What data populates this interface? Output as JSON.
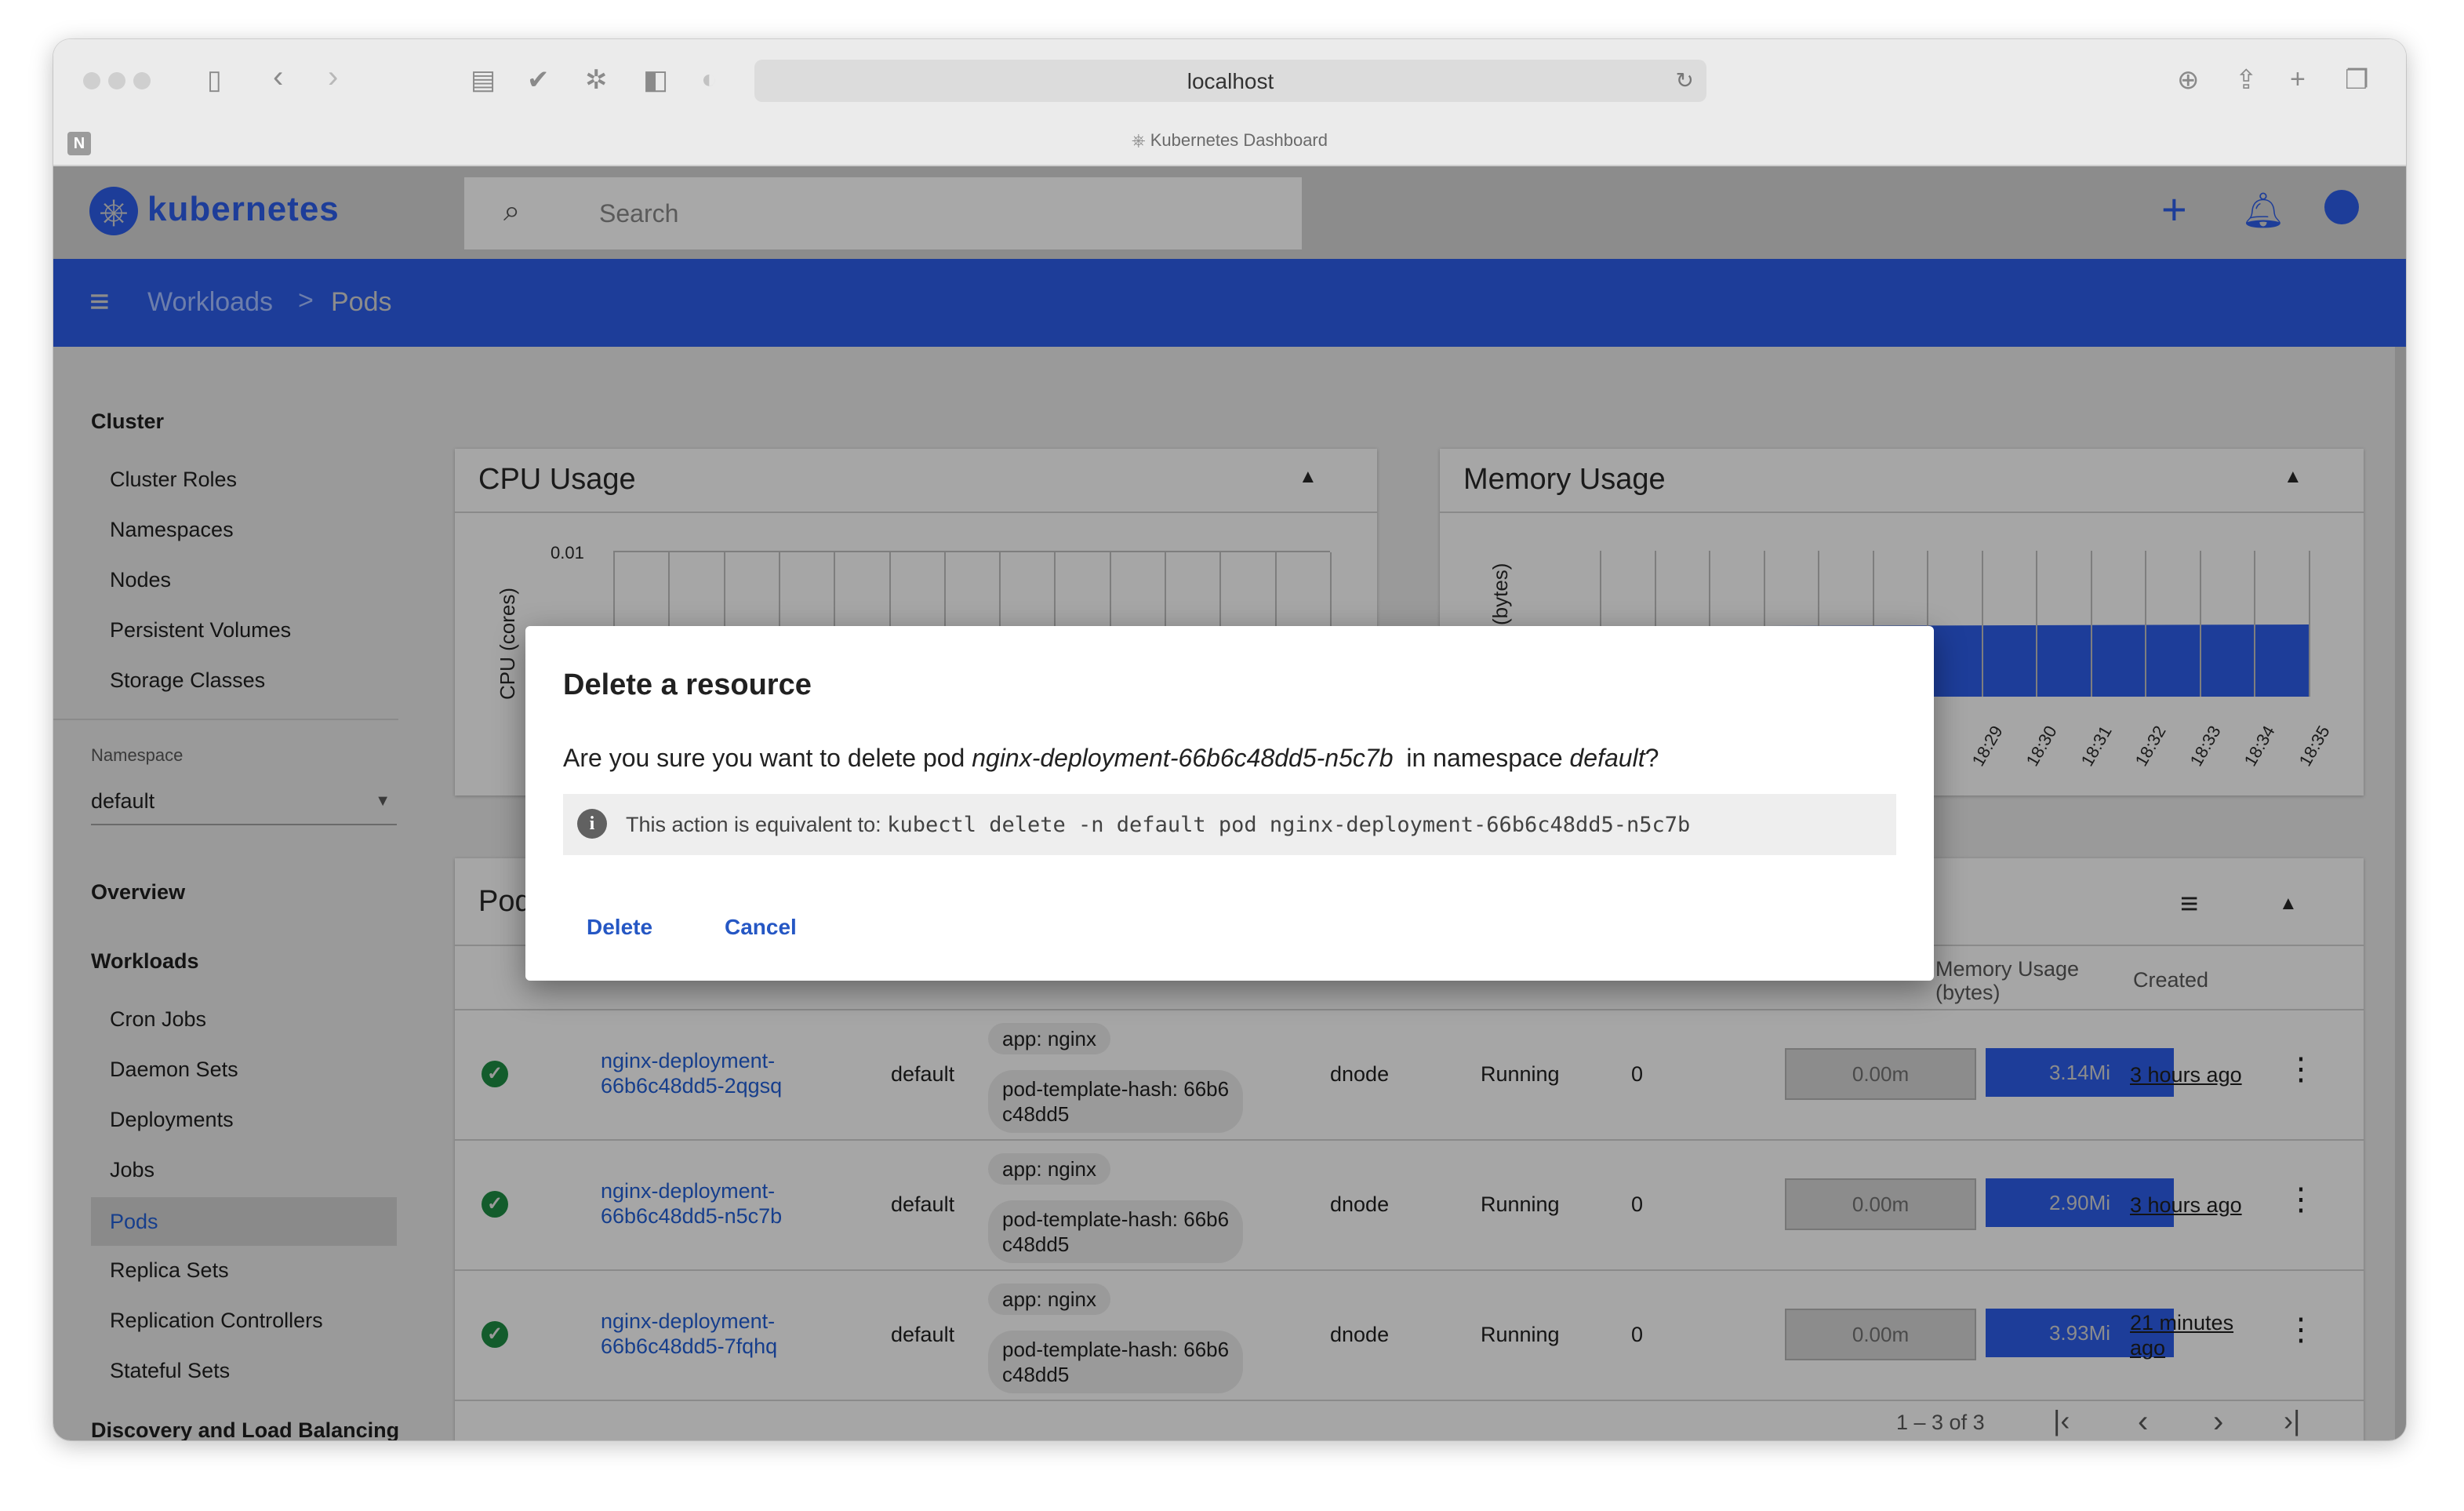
{
  "browser": {
    "url": "localhost",
    "tab_title": "Kubernetes Dashboard",
    "left_tab_letter": "N"
  },
  "app": {
    "brand": "kubernetes",
    "search_placeholder": "Search"
  },
  "breadcrumb": {
    "parent": "Workloads",
    "separator": ">",
    "current": "Pods"
  },
  "sidebar": {
    "cluster_header": "Cluster",
    "cluster_items": [
      "Cluster Roles",
      "Namespaces",
      "Nodes",
      "Persistent Volumes",
      "Storage Classes"
    ],
    "namespace_label": "Namespace",
    "namespace_value": "default",
    "overview": "Overview",
    "workloads_header": "Workloads",
    "workload_items": [
      "Cron Jobs",
      "Daemon Sets",
      "Deployments",
      "Jobs",
      "Pods",
      "Replica Sets",
      "Replication Controllers",
      "Stateful Sets"
    ],
    "active_item": "Pods",
    "discovery_header": "Discovery and Load Balancing"
  },
  "cpu_card": {
    "title": "CPU Usage",
    "ylabel": "CPU (cores)",
    "ytick": "0.01"
  },
  "memory_card": {
    "title": "Memory Usage",
    "ylabel_visible": "mory (bytes)",
    "xticks": [
      "18:29",
      "18:30",
      "18:31",
      "18:32",
      "18:33",
      "18:34",
      "18:35"
    ]
  },
  "pods_card": {
    "title_visible": "Pod",
    "col_memory": "Memory Usage (bytes)",
    "col_created": "Created",
    "pagination": "1 – 3 of 3",
    "rows": [
      {
        "name_line1": "nginx-deployment-",
        "name_line2": "66b6c48dd5-2qgsq",
        "namespace": "default",
        "label1": "app: nginx",
        "label2_line1": "pod-template-hash: 66b6",
        "label2_line2": "c48dd5",
        "node": "dnode",
        "status": "Running",
        "restarts": "0",
        "cpu": "0.00m",
        "memory": "3.14Mi",
        "memory_fill": 1.0,
        "created_line1": "3 hours ago",
        "created_line2": ""
      },
      {
        "name_line1": "nginx-deployment-",
        "name_line2": "66b6c48dd5-n5c7b",
        "namespace": "default",
        "label1": "app: nginx",
        "label2_line1": "pod-template-hash: 66b6",
        "label2_line2": "c48dd5",
        "node": "dnode",
        "status": "Running",
        "restarts": "0",
        "cpu": "0.00m",
        "memory": "2.90Mi",
        "memory_fill": 1.0,
        "created_line1": "3 hours ago",
        "created_line2": ""
      },
      {
        "name_line1": "nginx-deployment-",
        "name_line2": "66b6c48dd5-7fqhq",
        "namespace": "default",
        "label1": "app: nginx",
        "label2_line1": "pod-template-hash: 66b6",
        "label2_line2": "c48dd5",
        "node": "dnode",
        "status": "Running",
        "restarts": "0",
        "cpu": "0.00m",
        "memory": "3.93Mi",
        "memory_fill": 1.0,
        "created_line1": "21 minutes",
        "created_line2": "ago"
      }
    ]
  },
  "dialog": {
    "title": "Delete a resource",
    "msg_prefix": "Are you sure you want to delete pod ",
    "pod_name": "nginx-deployment-66b6c48dd5-n5c7b",
    "msg_middle": " in namespace ",
    "namespace": "default",
    "msg_suffix": "?",
    "info_prefix": "This action is equivalent to:",
    "info_command": "kubectl delete -n default pod nginx-deployment-66b6c48dd5-n5c7b",
    "delete_label": "Delete",
    "cancel_label": "Cancel"
  },
  "colors": {
    "toolbar_blue": "#1d3d99",
    "link_blue": "#2557c4",
    "success_green": "#135c2c"
  }
}
